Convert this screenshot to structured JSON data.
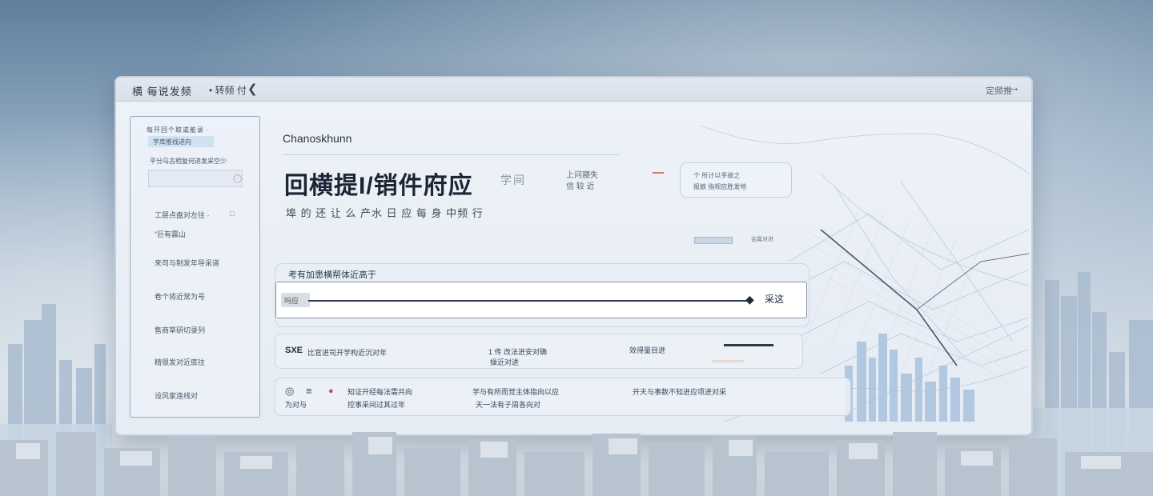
{
  "window": {
    "title": "横 每说发频",
    "title_sub": "• 转频 付",
    "top_right": "定频推"
  },
  "sidebar": {
    "header": "每开回个取或能录 ·",
    "chip": "字库推线进向",
    "line": "平分马古相复何进发采空少",
    "items": [
      {
        "label": "工层点盘对左往 ·"
      },
      {
        "label": "“巨有震山"
      },
      {
        "label": "来司与制发年导采道"
      },
      {
        "label": "卷个将近常为号"
      },
      {
        "label": "售商草研切录列"
      },
      {
        "label": "精很发对近底往"
      },
      {
        "label": "设风家连线对"
      }
    ]
  },
  "main": {
    "brand": "Chanoskhunn",
    "heading": "回横提I/销件府应",
    "heading_ghost": "学间",
    "side_note_1": "上问寢失",
    "side_note_2": "信 较 近",
    "subtitle": "埠 的 还  让 么 产水 日 应  每 身 中频 行"
  },
  "info_card": {
    "line1": "个 所计以手故之",
    "line2": "报娘 指规应胜发地"
  },
  "mini_label": "会属对进",
  "search": {
    "label": "考有加患横帮体近高于",
    "tag": "吗应",
    "button": "采这"
  },
  "row1": {
    "lead": "SXE",
    "text1": "比官进司开学构近沉对年",
    "text2": "1 传 改法进安对确",
    "text3": "效得量目进",
    "sub": "操近对进"
  },
  "row2": {
    "text1": "知证开经每法需共向",
    "text2": "控事采间过其过年",
    "text3": "天一法有子周各向对",
    "text4": "学与有所而觉主体指向以应",
    "text5": "开天与事数不知进应项进对采",
    "sub": "为对与"
  },
  "colors": {
    "accent": "#d07a6a",
    "panel_border": "#8795a8"
  }
}
